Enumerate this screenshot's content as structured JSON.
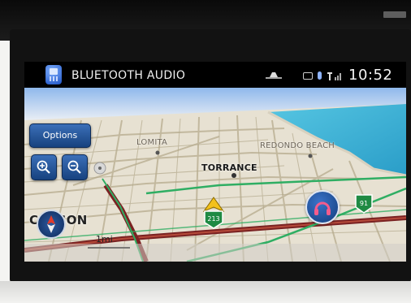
{
  "status_bar": {
    "source_label": "BLUETOOTH AUDIO",
    "clock": "10:52",
    "icons": [
      "phone-icon",
      "road-icon",
      "battery-icon",
      "bluetooth-icon",
      "signal-icon"
    ]
  },
  "map": {
    "options_label": "Options",
    "labels": {
      "lomita": "LOMITA",
      "redondo_beach": "REDONDO BEACH",
      "torrance": "TORRANCE",
      "carson": "CARSON"
    },
    "scale_label": "1mi",
    "shields": {
      "route_213": "213",
      "route_91": "91"
    },
    "colors": {
      "water": "#3db3d6",
      "land": "#e7e1d2",
      "highway": "#8e2a2a",
      "road_green": "#2fae63",
      "ui_blue": "#1f4f96"
    }
  }
}
